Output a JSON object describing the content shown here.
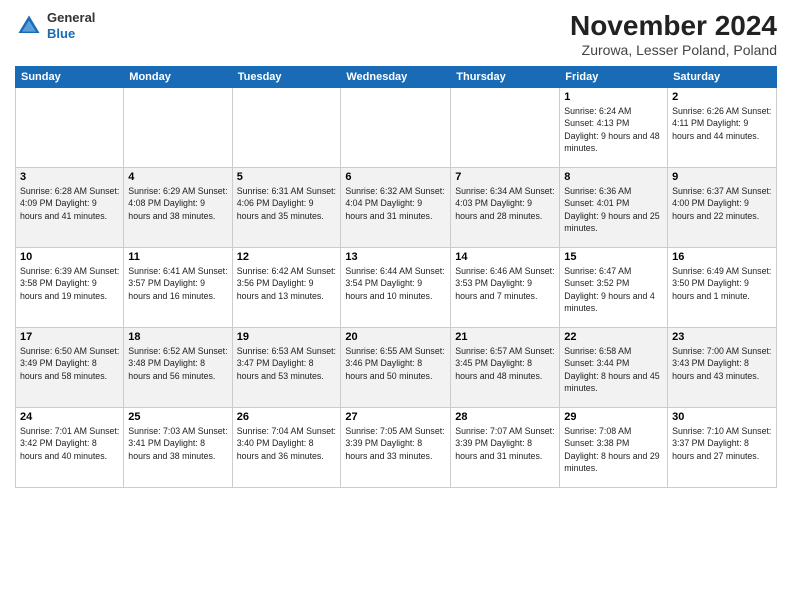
{
  "header": {
    "logo_general": "General",
    "logo_blue": "Blue",
    "month_title": "November 2024",
    "location": "Zurowa, Lesser Poland, Poland"
  },
  "weekdays": [
    "Sunday",
    "Monday",
    "Tuesday",
    "Wednesday",
    "Thursday",
    "Friday",
    "Saturday"
  ],
  "weeks": [
    [
      {
        "day": "",
        "info": ""
      },
      {
        "day": "",
        "info": ""
      },
      {
        "day": "",
        "info": ""
      },
      {
        "day": "",
        "info": ""
      },
      {
        "day": "",
        "info": ""
      },
      {
        "day": "1",
        "info": "Sunrise: 6:24 AM\nSunset: 4:13 PM\nDaylight: 9 hours and 48 minutes."
      },
      {
        "day": "2",
        "info": "Sunrise: 6:26 AM\nSunset: 4:11 PM\nDaylight: 9 hours and 44 minutes."
      }
    ],
    [
      {
        "day": "3",
        "info": "Sunrise: 6:28 AM\nSunset: 4:09 PM\nDaylight: 9 hours and 41 minutes."
      },
      {
        "day": "4",
        "info": "Sunrise: 6:29 AM\nSunset: 4:08 PM\nDaylight: 9 hours and 38 minutes."
      },
      {
        "day": "5",
        "info": "Sunrise: 6:31 AM\nSunset: 4:06 PM\nDaylight: 9 hours and 35 minutes."
      },
      {
        "day": "6",
        "info": "Sunrise: 6:32 AM\nSunset: 4:04 PM\nDaylight: 9 hours and 31 minutes."
      },
      {
        "day": "7",
        "info": "Sunrise: 6:34 AM\nSunset: 4:03 PM\nDaylight: 9 hours and 28 minutes."
      },
      {
        "day": "8",
        "info": "Sunrise: 6:36 AM\nSunset: 4:01 PM\nDaylight: 9 hours and 25 minutes."
      },
      {
        "day": "9",
        "info": "Sunrise: 6:37 AM\nSunset: 4:00 PM\nDaylight: 9 hours and 22 minutes."
      }
    ],
    [
      {
        "day": "10",
        "info": "Sunrise: 6:39 AM\nSunset: 3:58 PM\nDaylight: 9 hours and 19 minutes."
      },
      {
        "day": "11",
        "info": "Sunrise: 6:41 AM\nSunset: 3:57 PM\nDaylight: 9 hours and 16 minutes."
      },
      {
        "day": "12",
        "info": "Sunrise: 6:42 AM\nSunset: 3:56 PM\nDaylight: 9 hours and 13 minutes."
      },
      {
        "day": "13",
        "info": "Sunrise: 6:44 AM\nSunset: 3:54 PM\nDaylight: 9 hours and 10 minutes."
      },
      {
        "day": "14",
        "info": "Sunrise: 6:46 AM\nSunset: 3:53 PM\nDaylight: 9 hours and 7 minutes."
      },
      {
        "day": "15",
        "info": "Sunrise: 6:47 AM\nSunset: 3:52 PM\nDaylight: 9 hours and 4 minutes."
      },
      {
        "day": "16",
        "info": "Sunrise: 6:49 AM\nSunset: 3:50 PM\nDaylight: 9 hours and 1 minute."
      }
    ],
    [
      {
        "day": "17",
        "info": "Sunrise: 6:50 AM\nSunset: 3:49 PM\nDaylight: 8 hours and 58 minutes."
      },
      {
        "day": "18",
        "info": "Sunrise: 6:52 AM\nSunset: 3:48 PM\nDaylight: 8 hours and 56 minutes."
      },
      {
        "day": "19",
        "info": "Sunrise: 6:53 AM\nSunset: 3:47 PM\nDaylight: 8 hours and 53 minutes."
      },
      {
        "day": "20",
        "info": "Sunrise: 6:55 AM\nSunset: 3:46 PM\nDaylight: 8 hours and 50 minutes."
      },
      {
        "day": "21",
        "info": "Sunrise: 6:57 AM\nSunset: 3:45 PM\nDaylight: 8 hours and 48 minutes."
      },
      {
        "day": "22",
        "info": "Sunrise: 6:58 AM\nSunset: 3:44 PM\nDaylight: 8 hours and 45 minutes."
      },
      {
        "day": "23",
        "info": "Sunrise: 7:00 AM\nSunset: 3:43 PM\nDaylight: 8 hours and 43 minutes."
      }
    ],
    [
      {
        "day": "24",
        "info": "Sunrise: 7:01 AM\nSunset: 3:42 PM\nDaylight: 8 hours and 40 minutes."
      },
      {
        "day": "25",
        "info": "Sunrise: 7:03 AM\nSunset: 3:41 PM\nDaylight: 8 hours and 38 minutes."
      },
      {
        "day": "26",
        "info": "Sunrise: 7:04 AM\nSunset: 3:40 PM\nDaylight: 8 hours and 36 minutes."
      },
      {
        "day": "27",
        "info": "Sunrise: 7:05 AM\nSunset: 3:39 PM\nDaylight: 8 hours and 33 minutes."
      },
      {
        "day": "28",
        "info": "Sunrise: 7:07 AM\nSunset: 3:39 PM\nDaylight: 8 hours and 31 minutes."
      },
      {
        "day": "29",
        "info": "Sunrise: 7:08 AM\nSunset: 3:38 PM\nDaylight: 8 hours and 29 minutes."
      },
      {
        "day": "30",
        "info": "Sunrise: 7:10 AM\nSunset: 3:37 PM\nDaylight: 8 hours and 27 minutes."
      }
    ]
  ]
}
